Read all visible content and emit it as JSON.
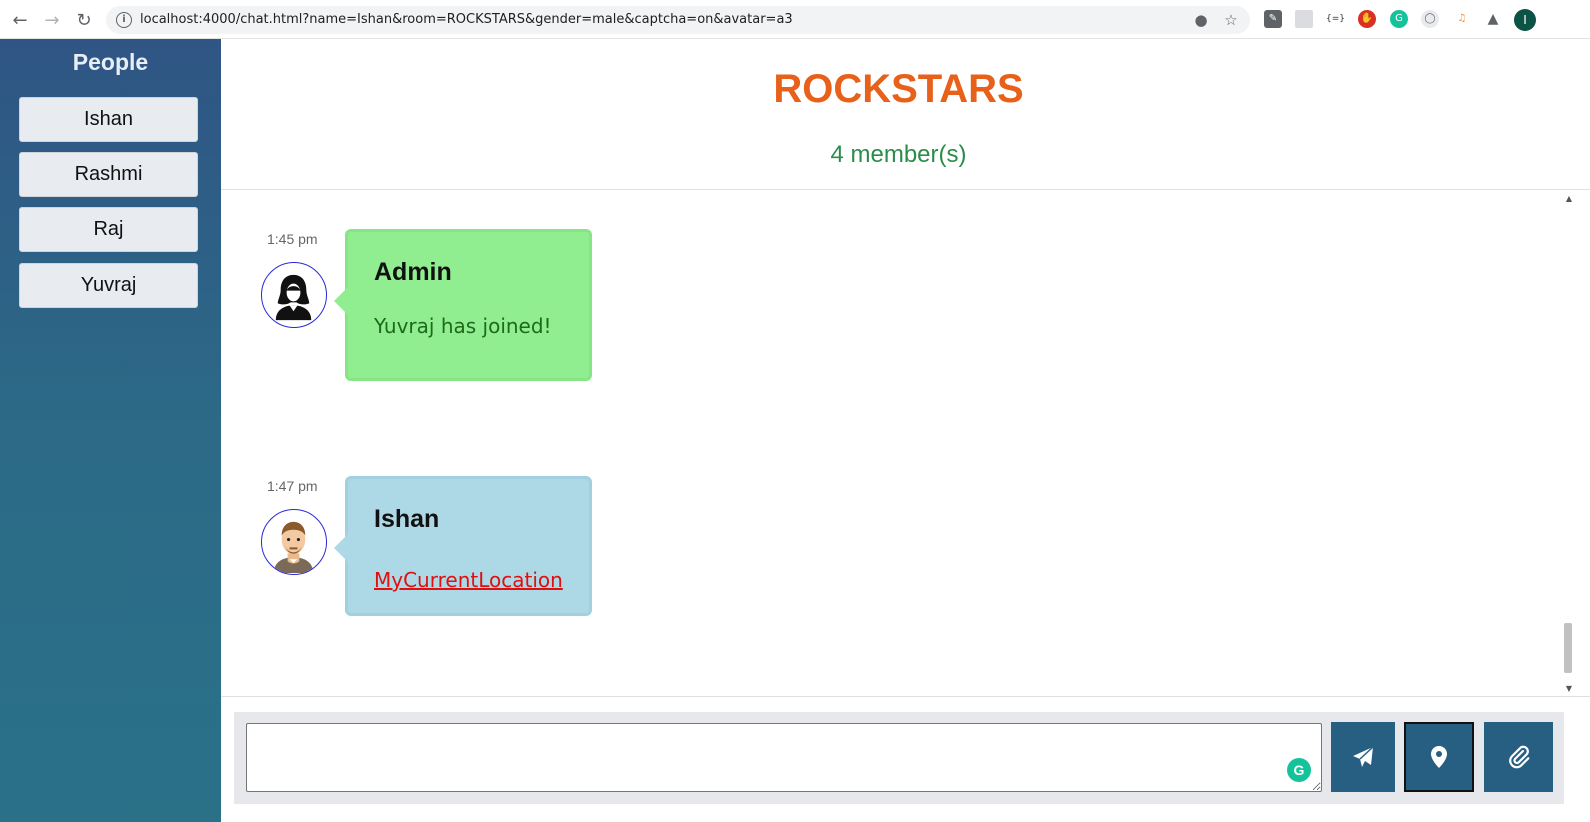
{
  "browser": {
    "url": "localhost:4000/chat.html?name=Ishan&room=ROCKSTARS&gender=male&captcha=on&avatar=a3",
    "profile_initial": "I"
  },
  "sidebar": {
    "title": "People",
    "people": [
      "Ishan",
      "Rashmi",
      "Raj",
      "Yuvraj"
    ]
  },
  "room": {
    "name": "ROCKSTARS",
    "member_count": "4 member(s)"
  },
  "messages": [
    {
      "time": "1:45 pm",
      "sender": "Admin",
      "text": "Yuvraj has joined!",
      "avatar": "female-avatar-icon",
      "color": "#90ee90"
    },
    {
      "time": "1:47 pm",
      "sender": "Ishan",
      "link_text": "MyCurrentLocation",
      "avatar": "male-avatar-icon",
      "color": "#add8e6"
    }
  ],
  "composer": {
    "input_value": "",
    "buttons": [
      "send-icon",
      "location-pin-icon",
      "paperclip-icon"
    ]
  },
  "colors": {
    "accent": "#275f82",
    "room_title": "#e8611a",
    "member_count": "#2c8c4c",
    "link": "#e01010"
  }
}
